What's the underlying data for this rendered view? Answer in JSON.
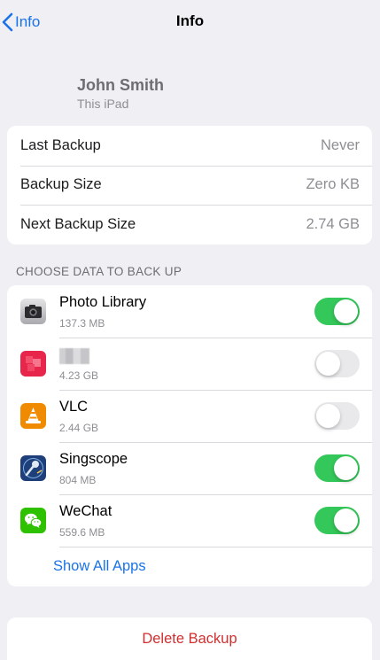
{
  "nav": {
    "back_label": "Info",
    "title": "Info"
  },
  "device": {
    "name": "John Smith",
    "subtitle": "This iPad"
  },
  "backup_info": [
    {
      "label": "Last Backup",
      "value": "Never"
    },
    {
      "label": "Backup Size",
      "value": "Zero KB"
    },
    {
      "label": "Next Backup Size",
      "value": "2.74 GB"
    }
  ],
  "section_header": "CHOOSE DATA TO BACK UP",
  "apps": [
    {
      "name": "Photo Library",
      "size": "137.3 MB",
      "enabled": true,
      "icon": "camera-icon"
    },
    {
      "name": "",
      "size": "4.23 GB",
      "enabled": false,
      "icon": "redacted-app-icon"
    },
    {
      "name": "VLC",
      "size": "2.44 GB",
      "enabled": false,
      "icon": "vlc-cone-icon"
    },
    {
      "name": "Singscope",
      "size": "804 MB",
      "enabled": true,
      "icon": "microphone-icon"
    },
    {
      "name": "WeChat",
      "size": "559.6 MB",
      "enabled": true,
      "icon": "wechat-icon"
    }
  ],
  "show_all_label": "Show All Apps",
  "delete_label": "Delete Backup",
  "colors": {
    "accent": "#1a73e8",
    "toggle_on": "#34c759",
    "destructive": "#d12f2f"
  }
}
